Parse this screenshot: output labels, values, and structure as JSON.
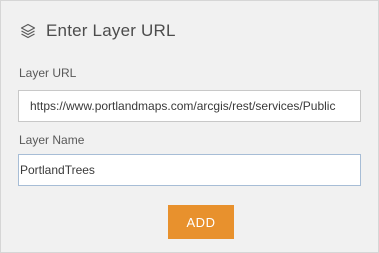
{
  "dialog": {
    "title": "Enter Layer URL",
    "header_icon": "layers-icon"
  },
  "layer_url": {
    "label": "Layer URL",
    "value": "https://www.portlandmaps.com/arcgis/rest/services/Public"
  },
  "layer_name": {
    "label": "Layer Name",
    "value": "PortlandTrees"
  },
  "add_button": {
    "label": "ADD",
    "color": "#e8912d"
  }
}
